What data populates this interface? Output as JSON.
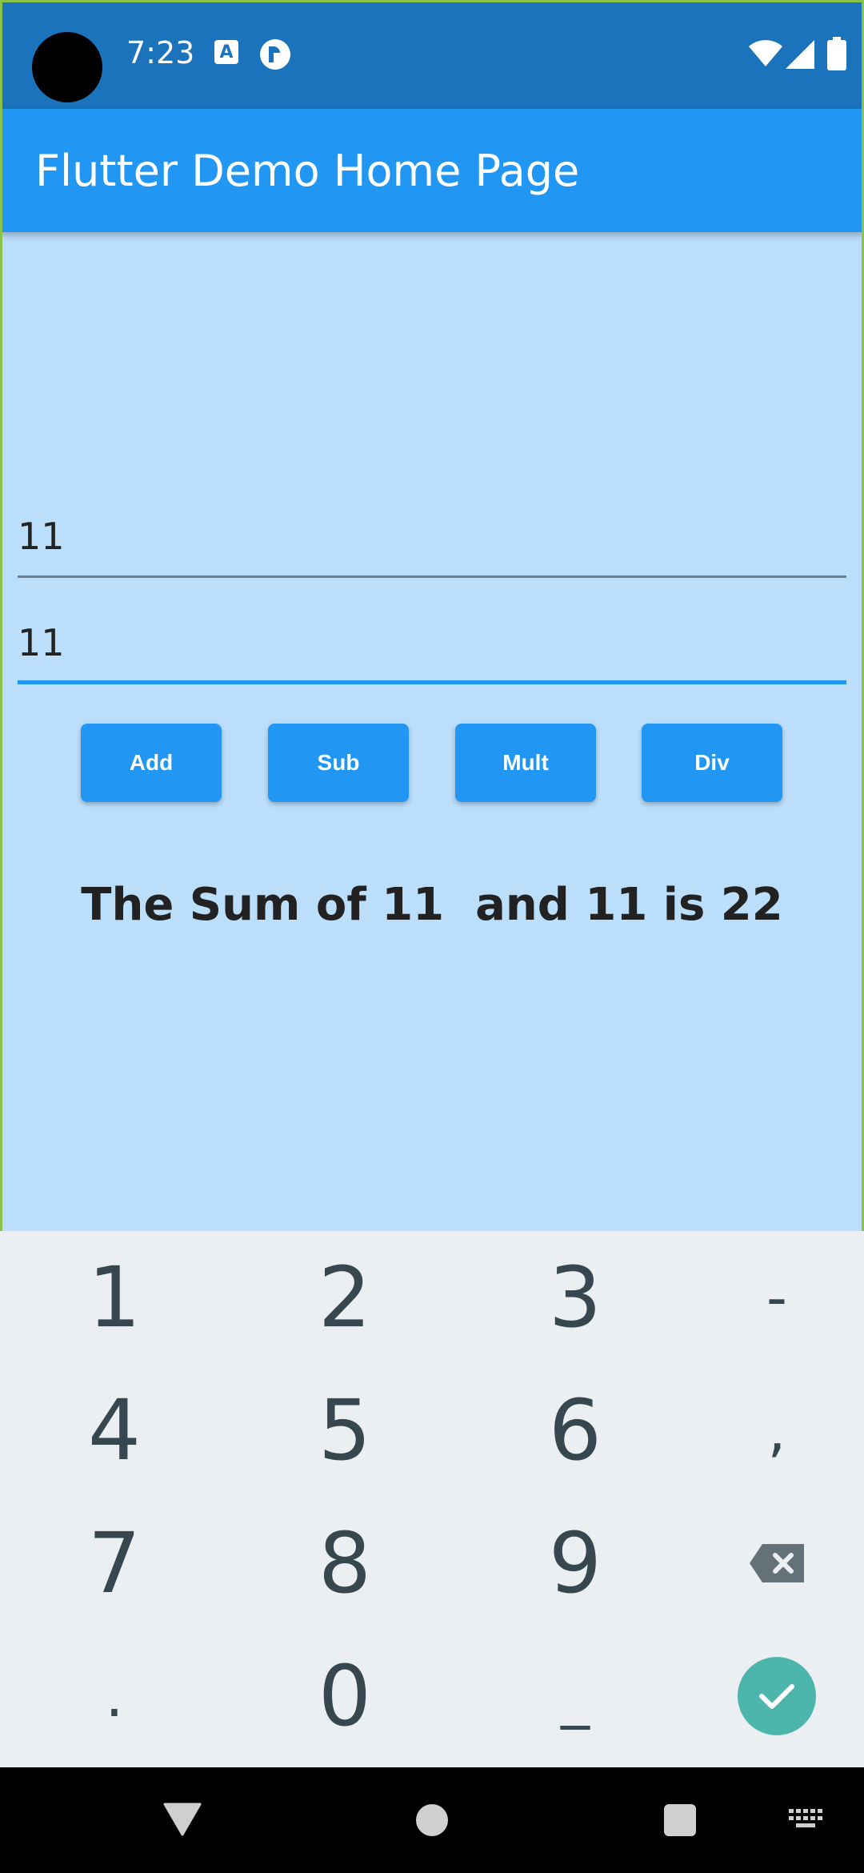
{
  "status_bar": {
    "time": "7:23",
    "icons": [
      "accessibility-a-icon",
      "r-notification-icon",
      "wifi-icon",
      "signal-icon",
      "battery-icon"
    ]
  },
  "app_bar": {
    "title": "Flutter Demo Home Page"
  },
  "inputs": {
    "first_value": "11",
    "second_value": "11"
  },
  "buttons": {
    "add": "Add",
    "sub": "Sub",
    "mult": "Mult",
    "div": "Div"
  },
  "result": {
    "text": "The Sum of 11  and 11 is 22"
  },
  "keyboard": {
    "rows": [
      [
        "1",
        "2",
        "3",
        "-"
      ],
      [
        "4",
        "5",
        "6",
        ","
      ],
      [
        "7",
        "8",
        "9",
        "backspace"
      ],
      [
        ".",
        "0",
        "_",
        "done"
      ]
    ]
  },
  "nav_bar": {
    "icons": [
      "back-icon",
      "home-icon",
      "recents-icon",
      "keyboard-icon"
    ]
  },
  "colors": {
    "status_bar": "#1A73BB",
    "app_bar": "#2196F3",
    "background": "#BBDEFB",
    "keyboard_bg": "#ECEFF1",
    "enter_key": "#4DB6AC"
  }
}
